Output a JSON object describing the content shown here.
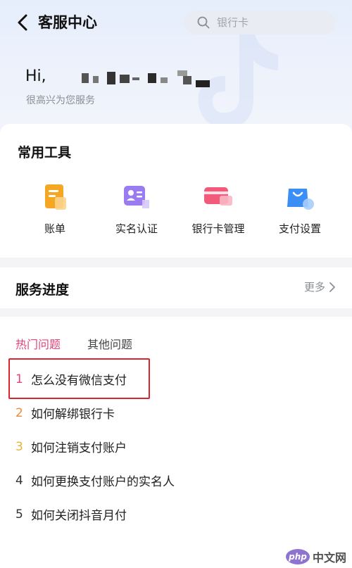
{
  "header": {
    "title": "客服中心",
    "search_placeholder": "银行卡"
  },
  "greeting": {
    "hello": "Hi,",
    "subtitle": "很高兴为您服务"
  },
  "tools": {
    "title": "常用工具",
    "items": [
      {
        "label": "账单",
        "icon": "bill-icon",
        "color": "#f5a623"
      },
      {
        "label": "实名认证",
        "icon": "id-card-icon",
        "color": "#9b7cf0"
      },
      {
        "label": "银行卡管理",
        "icon": "bank-card-icon",
        "color": "#f25a7a"
      },
      {
        "label": "支付设置",
        "icon": "shopping-bag-icon",
        "color": "#3b8ef5"
      }
    ]
  },
  "progress": {
    "title": "服务进度",
    "more_label": "更多"
  },
  "faq": {
    "tabs": [
      {
        "label": "热门问题",
        "active": true
      },
      {
        "label": "其他问题",
        "active": false
      }
    ],
    "questions": [
      {
        "num": "1",
        "text": "怎么没有微信支付",
        "num_color": "#e0447a"
      },
      {
        "num": "2",
        "text": "如何解绑银行卡",
        "num_color": "#f08a3a"
      },
      {
        "num": "3",
        "text": "如何注销支付账户",
        "num_color": "#e8b13a"
      },
      {
        "num": "4",
        "text": "如何更换支付账户的实名人",
        "num_color": "#333333"
      },
      {
        "num": "5",
        "text": "如何关闭抖音月付",
        "num_color": "#333333"
      }
    ]
  },
  "watermark": {
    "badge": "php",
    "text": "中文网"
  },
  "colors": {
    "accent": "#e0447a",
    "highlight_border": "#d9262c"
  }
}
